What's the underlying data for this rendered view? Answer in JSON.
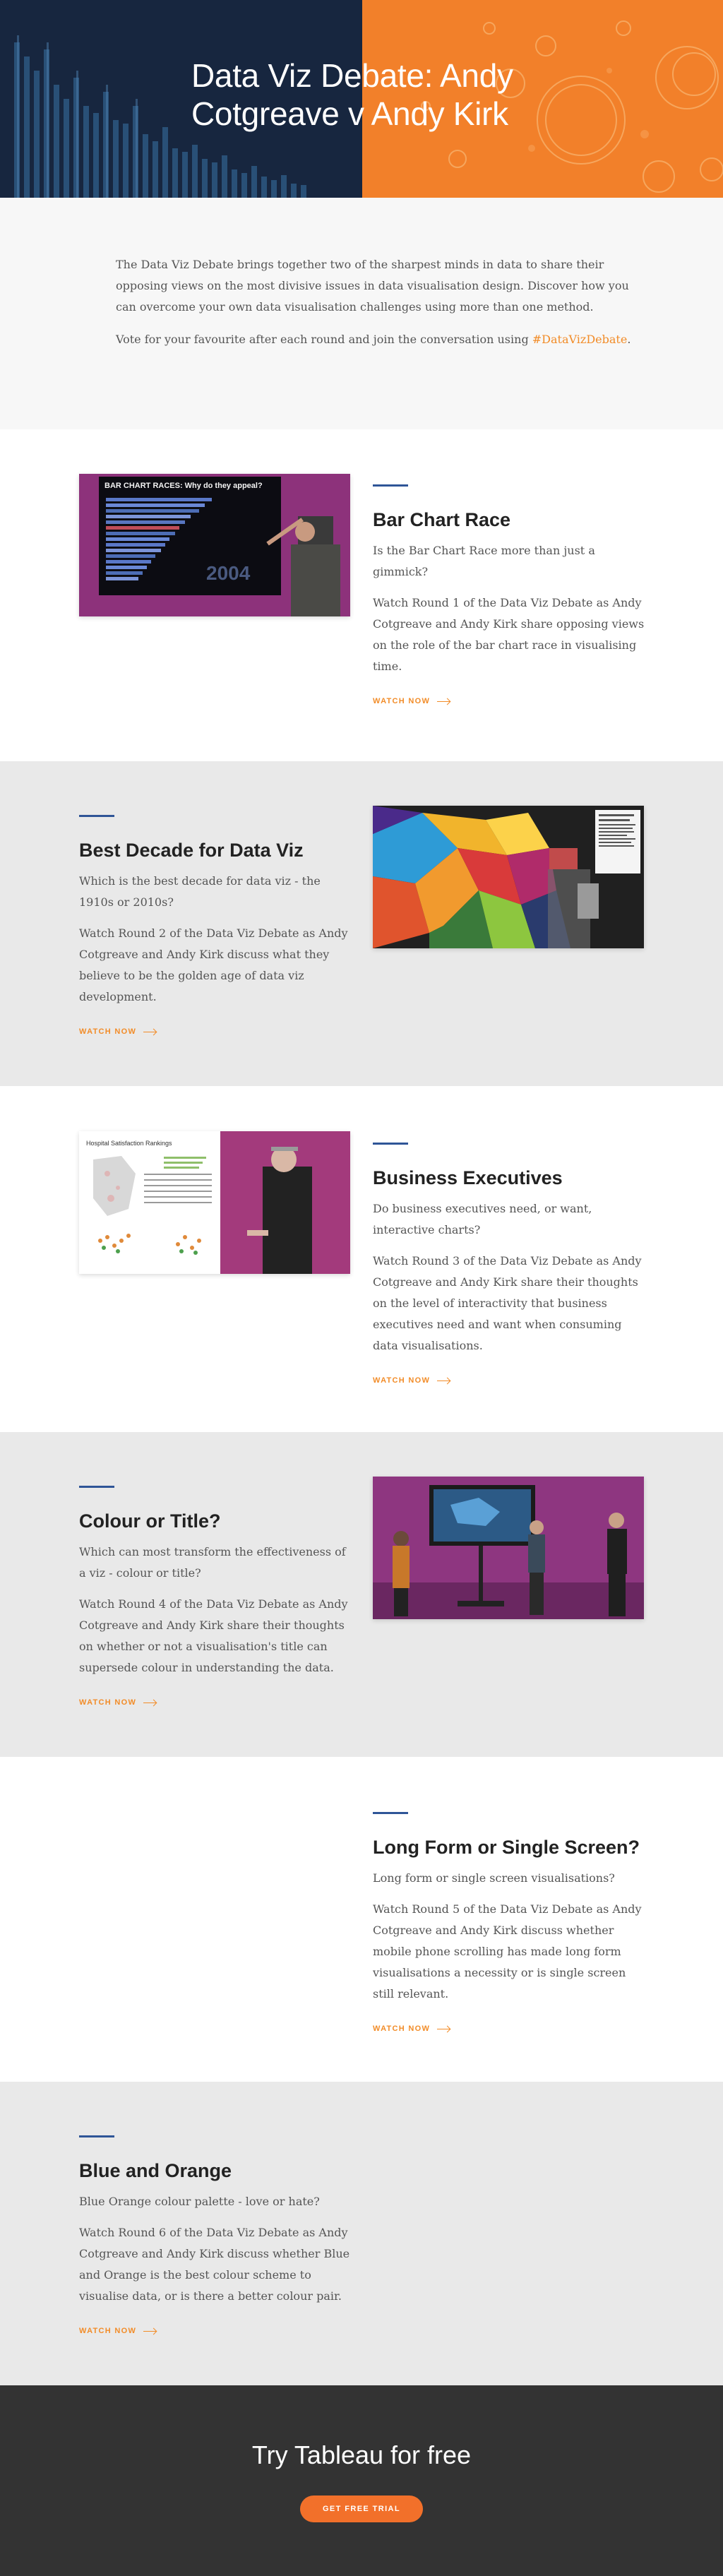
{
  "hero": {
    "title": "Data Viz Debate: Andy Cotgreave v Andy Kirk",
    "colors": {
      "left": "#17263f",
      "right": "#f2802a"
    }
  },
  "intro": {
    "paragraph1": "The Data Viz Debate brings together two of the sharpest minds in data to share their opposing views on the most divisive issues in data visualisation design. Discover how you can overcome your own data visualisation challenges using more than one method.",
    "paragraph2_prefix": "Vote for your favourite after each round and join the conversation using ",
    "hashtag": "#DataVizDebate",
    "paragraph2_suffix": "."
  },
  "sections": [
    {
      "title": "Bar Chart Race",
      "question": "Is the Bar Chart Race more than just a gimmick?",
      "description": "Watch Round 1 of the Data Viz Debate as Andy Cotgreave and Andy Kirk share opposing views on the role of the bar chart race in visualising time.",
      "cta": "WATCH NOW",
      "thumb_caption": "BAR CHART RACES: Why do they appeal?",
      "thumb_year": "2004"
    },
    {
      "title": "Best Decade for Data Viz",
      "question": "Which is the best decade for data viz - the 1910s or 2010s?",
      "description": "Watch Round 2 of the Data Viz Debate as Andy Cotgreave and Andy Kirk discuss what they believe to be the golden age of data viz development.",
      "cta": "WATCH NOW"
    },
    {
      "title": "Business Executives",
      "question": "Do business executives need, or want, interactive charts?",
      "description": "Watch Round 3 of the Data Viz Debate as Andy Cotgreave and Andy Kirk share their thoughts on the level of interactivity that business executives need and want when consuming data visualisations.",
      "cta": "WATCH NOW",
      "thumb_caption": "Hospital Satisfaction Rankings"
    },
    {
      "title": "Colour or Title?",
      "question": "Which can most transform the effectiveness of a viz - colour or title?",
      "description": "Watch Round 4 of the Data Viz Debate as Andy Cotgreave and Andy Kirk share their thoughts on whether or not a visualisation's title can supersede colour in understanding the data.",
      "cta": "WATCH NOW"
    },
    {
      "title": "Long Form or Single Screen?",
      "question": "Long form or single screen visualisations?",
      "description": "Watch Round 5 of the Data Viz Debate as Andy Cotgreave and Andy Kirk discuss whether mobile phone scrolling has made long form visualisations a necessity or is single screen still relevant.",
      "cta": "WATCH NOW"
    },
    {
      "title": "Blue and Orange",
      "question": "Blue Orange colour palette - love or hate?",
      "description": "Watch Round 6 of the Data Viz Debate as Andy Cotgreave and Andy Kirk discuss whether Blue and Orange is the best colour scheme to visualise data, or is there a better colour pair.",
      "cta": "WATCH NOW"
    }
  ],
  "cta_footer": {
    "title": "Try Tableau for free",
    "button": "GET FREE TRIAL"
  },
  "colors": {
    "accent_orange": "#f28c28",
    "accent_blue": "#2f5597",
    "footer_bg": "#333333"
  }
}
